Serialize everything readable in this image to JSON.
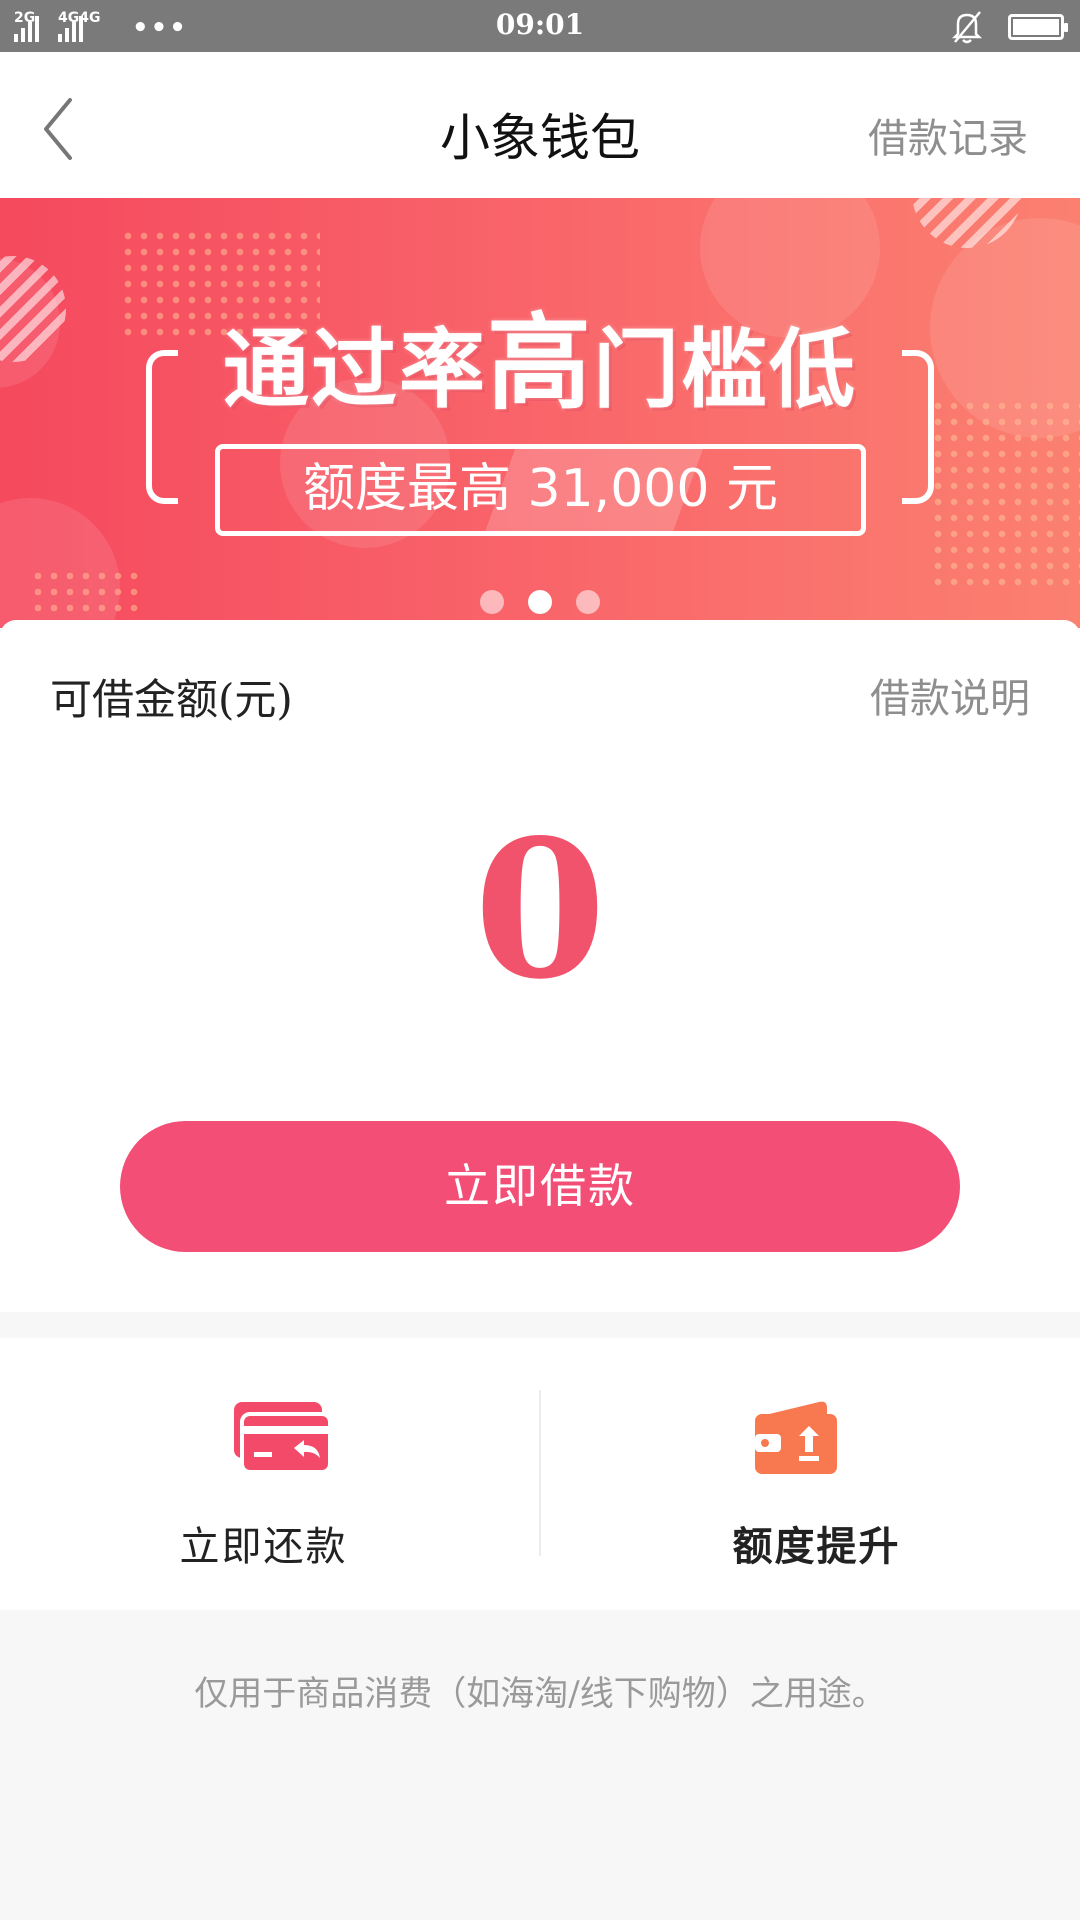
{
  "status_bar": {
    "signal_1": "2G",
    "signal_2": "4G",
    "signal_3": "4G",
    "more": "•••",
    "time": "09:01",
    "icons": [
      "signal-icon",
      "signal-icon",
      "more-icon",
      "notification-muted-icon",
      "battery-icon"
    ]
  },
  "header": {
    "back_icon": "chevron-left-icon",
    "title": "小象钱包",
    "right_link": "借款记录"
  },
  "banner": {
    "headline_part1": "通过率",
    "headline_big": "高",
    "headline_part2": "门槛低",
    "amount_text": "额度最高 31,000 元",
    "active_page": 2,
    "page_count": 3,
    "colors": {
      "gradient_start": "#f5495e",
      "gradient_end": "#fb8070"
    }
  },
  "borrow": {
    "label": "可借金额(元)",
    "info_link": "借款说明",
    "amount": "0",
    "button": "立即借款",
    "colors": {
      "amount": "#f2536c",
      "button": "#f24e76"
    }
  },
  "actions": [
    {
      "label": "立即还款",
      "icon": "card-repay-icon",
      "color": "#f34a6a"
    },
    {
      "label": "额度提升",
      "icon": "wallet-upgrade-icon",
      "color": "#f87950"
    }
  ],
  "footer": {
    "note": "仅用于商品消费（如海淘/线下购物）之用途。"
  }
}
